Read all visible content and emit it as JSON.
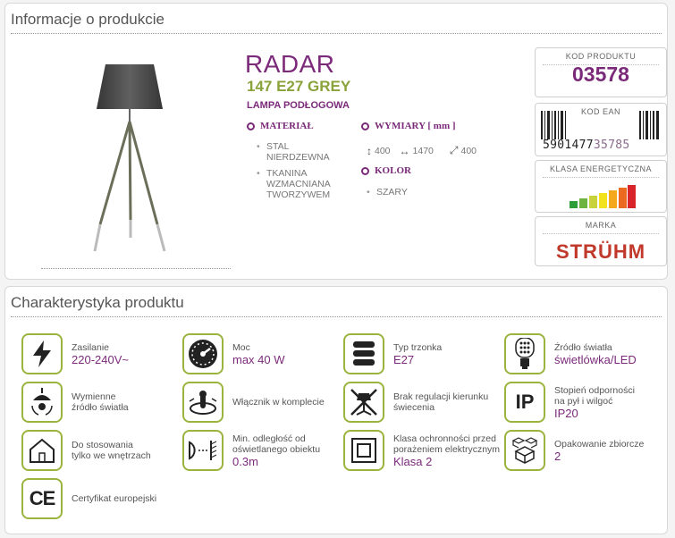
{
  "section1": {
    "title": "Informacje o produkcie"
  },
  "product": {
    "name": "RADAR",
    "variant": "147 E27 GREY",
    "type": "LAMPA PODŁOGOWA",
    "material_label": "MATERIAŁ",
    "materials": [
      "STAL NIERDZEWNA",
      "TKANINA WZMACNIANA TWORZYWEM"
    ],
    "dimensions_label": "WYMIARY [ mm ]",
    "dimensions": {
      "height": "400",
      "width": "1470",
      "diagonal": "400"
    },
    "color_label": "KOLOR",
    "color": "SZARY"
  },
  "info_boxes": {
    "code_label": "KOD PRODUKTU",
    "code": "03578",
    "ean_label": "KOD EAN",
    "ean_main": "5901477",
    "ean_hl": "35785",
    "energy_label": "KLASA ENERGETYCZNA",
    "brand_label": "MARKA",
    "brand": "STRÜHM"
  },
  "section2": {
    "title": "Charakterystyka produktu"
  },
  "features": [
    {
      "label": "Zasilanie",
      "value": "220-240V~"
    },
    {
      "label": "Moc",
      "value": "max 40 W"
    },
    {
      "label": "Typ trzonka",
      "value": "E27"
    },
    {
      "label": "Źródło światła",
      "value": "świetlówka/LED"
    },
    {
      "label": "Wymienne źródło światła",
      "value": ""
    },
    {
      "label": "Włącznik w komplecie",
      "value": ""
    },
    {
      "label": "Brak regulacji kierunku świecenia",
      "value": ""
    },
    {
      "label": "Stopień odporności na pył i wilgoć",
      "value": "IP20"
    },
    {
      "label": "Do stosowania tylko we wnętrzach",
      "value": ""
    },
    {
      "label": "Min. odległość od oświetlanego obiektu",
      "value": "0.3m"
    },
    {
      "label": "Klasa ochronności przed porażeniem elektrycznym",
      "value": "Klasa 2"
    },
    {
      "label": "Opakowanie zbiorcze",
      "value": "2"
    },
    {
      "label": "Certyfikat europejski",
      "value": ""
    }
  ],
  "icons": [
    "lightning-icon",
    "gauge-icon",
    "socket-icon",
    "led-bulb-icon",
    "bulb-replace-icon",
    "switch-icon",
    "no-direction-icon",
    "ip-icon",
    "house-icon",
    "distance-icon",
    "class2-icon",
    "boxes-icon",
    "ce-icon"
  ],
  "colors": {
    "brand_purple": "#7b2a7a",
    "variant_green": "#8aa23a",
    "icon_border": "#9ab43e"
  }
}
